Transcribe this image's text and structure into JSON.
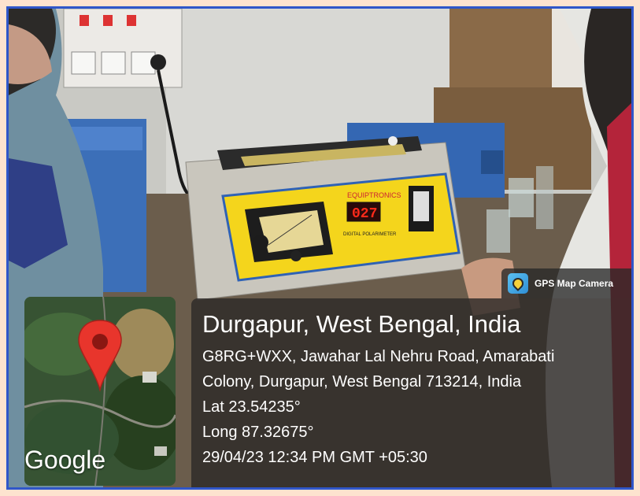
{
  "overlay": {
    "app_label": "GPS Map Camera",
    "app_icon": "gps-map-camera-icon",
    "map_brand": "Google",
    "place_title": "Durgapur, West Bengal, India",
    "address_line1": "G8RG+WXX, Jawahar Lal Nehru Road, Amarabati",
    "address_line2": "Colony, Durgapur, West Bengal 713214, India",
    "latitude": "Lat 23.54235°",
    "longitude": "Long 87.32675°",
    "timestamp": "29/04/23 12:34 PM GMT +05:30"
  },
  "device": {
    "brand": "EQUIPTRONICS",
    "display_value": "027",
    "model_label": "DIGITAL POLARIMETER"
  },
  "colors": {
    "frame_border": "#2f56c9",
    "page_background": "#fde3cf",
    "device_panel": "#f4d51c",
    "display_digits": "#ff2a1a",
    "map_pin": "#e8352c"
  }
}
